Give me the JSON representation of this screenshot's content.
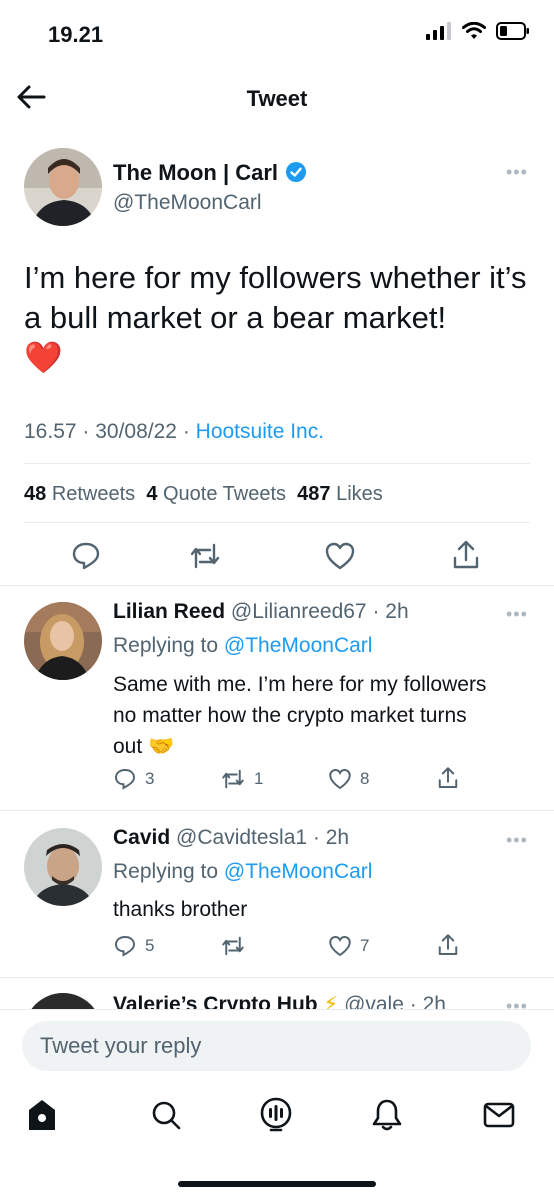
{
  "status_bar": {
    "time": "19.21"
  },
  "header": {
    "title": "Tweet"
  },
  "tweet": {
    "author_name": "The Moon | Carl",
    "author_handle": "@TheMoonCarl",
    "text": "I’m here for my followers whether it’s a bull market or a bear market!",
    "emoji": "❤️",
    "time": "16.57",
    "date": "30/08/22",
    "source": "Hootsuite Inc.",
    "retweets_count": "48",
    "retweets_label": "Retweets",
    "quote_count": "4",
    "quote_label": "Quote Tweets",
    "likes_count": "487",
    "likes_label": "Likes"
  },
  "replies": [
    {
      "name": "Lilian Reed",
      "handle": "@Lilianreed67",
      "age": "2h",
      "replying_label": "Replying to",
      "replying_to": "@TheMoonCarl",
      "text_line1": "Same with me. I’m here for my followers",
      "text_line2": "no matter how the crypto market turns",
      "text_line3": "out",
      "emoji": "🤝",
      "reply_count": "3",
      "retweet_count": "1",
      "like_count": "8"
    },
    {
      "name": "Cavid",
      "handle": "@Cavidtesla1",
      "age": "2h",
      "replying_label": "Replying to",
      "replying_to": "@TheMoonCarl",
      "text_line1": "thanks brother",
      "reply_count": "5",
      "like_count": "7"
    },
    {
      "name": "Valerie’s Crypto Hub",
      "handle": "@vale",
      "age": "2h"
    }
  ],
  "compose": {
    "placeholder": "Tweet your reply"
  },
  "tab_bar": {
    "icons": [
      "home-icon",
      "search-icon",
      "spaces-icon",
      "notifications-icon",
      "messages-icon"
    ]
  },
  "colors": {
    "accent": "#1d9bf0",
    "like_red": "#e0245e",
    "text": "#0f1419",
    "secondary": "#536471"
  }
}
